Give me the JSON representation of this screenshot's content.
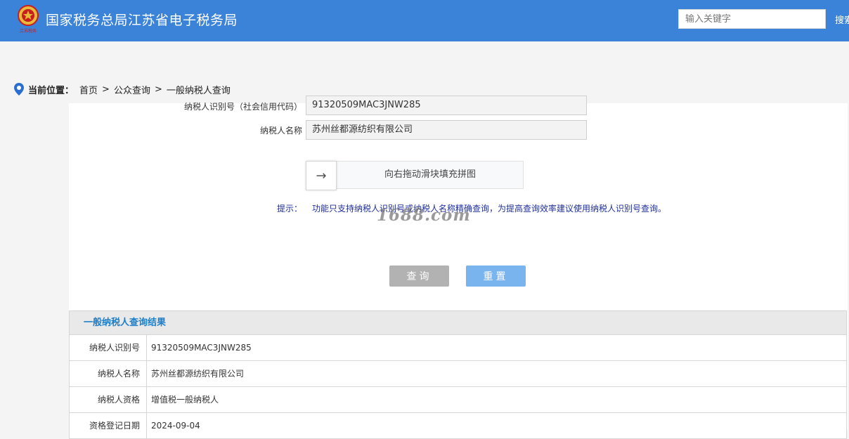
{
  "header": {
    "title": "国家税务总局江苏省电子税务局",
    "logo_text": "江苏税务",
    "search_placeholder": "输入关键字",
    "search_label": "搜索"
  },
  "breadcrumb": {
    "label": "当前位置：",
    "items": [
      "首页",
      "公众查询",
      "一般纳税人查询"
    ],
    "separator": ">"
  },
  "form": {
    "id_label": "纳税人识别号（社会信用代码）",
    "id_value": "91320509MAC3JNW285",
    "name_label": "纳税人名称",
    "name_value": "苏州丝都源纺织有限公司",
    "slider_arrow": "→",
    "slider_text": "向右拖动滑块填充拼图",
    "tip_label": "提示：",
    "tip_text": "功能只支持纳税人识别号或纳税人名称精确查询，为提高查询效率建议使用纳税人识别号查询。",
    "query_label": "查询",
    "reset_label": "重置"
  },
  "watermark": "1688.com",
  "result": {
    "title": "一般纳税人查询结果",
    "rows": [
      {
        "key": "纳税人识别号",
        "value": "91320509MAC3JNW285"
      },
      {
        "key": "纳税人名称",
        "value": "苏州丝都源纺织有限公司"
      },
      {
        "key": "纳税人资格",
        "value": "增值税一般纳税人"
      },
      {
        "key": "资格登记日期",
        "value": "2024-09-04"
      }
    ]
  },
  "colors": {
    "header_bg": "#3b82d9",
    "tip_text": "#1f2f9c",
    "result_title": "#1c7ec8",
    "query_button": "#b2b2b2",
    "reset_button": "#79b4ef"
  }
}
